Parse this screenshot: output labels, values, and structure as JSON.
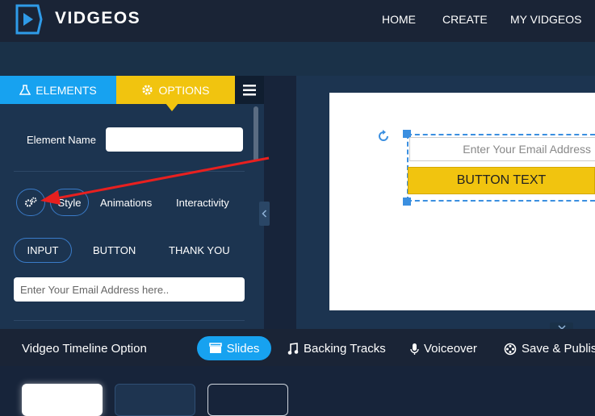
{
  "header": {
    "brand": "VIDGEOS",
    "nav": [
      {
        "label": "HOME"
      },
      {
        "label": "CREATE"
      },
      {
        "label": "MY VIDGEOS"
      }
    ]
  },
  "panel": {
    "tabs": {
      "elements": "ELEMENTS",
      "options": "OPTIONS"
    },
    "element_name_label": "Element Name",
    "element_name_value": "",
    "subtabs": {
      "style": "Style",
      "animations": "Animations",
      "interactivity": "Interactivity"
    },
    "type_tabs": {
      "input": "INPUT",
      "button": "BUTTON",
      "thank_you": "THANK YOU"
    },
    "email_field_value": "Enter Your Email Address here.."
  },
  "canvas": {
    "input_placeholder": "Enter Your Email Address",
    "button_text": "BUTTON TEXT"
  },
  "timeline": {
    "label": "Vidgeo Timeline Option",
    "items": {
      "slides": "Slides",
      "backing_tracks": "Backing Tracks",
      "voiceover": "Voiceover",
      "save_publish": "Save & Publish"
    }
  },
  "colors": {
    "accent_blue": "#17a2f0",
    "accent_yellow": "#f1c40f",
    "annotation_red": "#e8201f"
  },
  "icons": [
    "logo-play-icon",
    "flask-icon",
    "gear-icon",
    "hamburger-menu-icon",
    "gears-icon",
    "rotate-icon",
    "clapperboard-icon",
    "music-note-icon",
    "microphone-icon",
    "film-reel-icon",
    "chevron-left-icon",
    "chevron-down-icon"
  ]
}
